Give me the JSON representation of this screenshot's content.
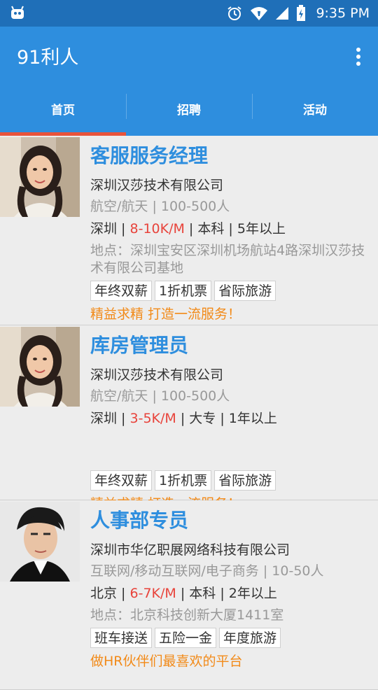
{
  "status_bar": {
    "time": "9:35 PM",
    "icons": [
      "android-debug-icon",
      "alarm-icon",
      "wifi-icon",
      "signal-icon",
      "battery-icon"
    ]
  },
  "app_bar": {
    "title": "91利人",
    "menu_icon": "more-vert-icon"
  },
  "tabs": [
    {
      "label": "首页",
      "selected": true
    },
    {
      "label": "招聘",
      "selected": false
    },
    {
      "label": "活动",
      "selected": false
    }
  ],
  "colors": {
    "status_bar": "#1f6fb8",
    "primary": "#2e8ede",
    "indicator": "#e8533b",
    "salary": "#e8433b",
    "slogan": "#f28a18"
  },
  "jobs": [
    {
      "title": "客服服务经理",
      "company": "深圳汉莎技术有限公司",
      "industry": "航空/航天 | 100-500人",
      "city": "深圳",
      "salary": "8-10K/M",
      "degree": "本科",
      "experience": "5年以上",
      "address": "地点：深圳宝安区深圳机场航站4路深圳汉莎技术有限公司基地",
      "tags": [
        "年终双薪",
        "1折机票",
        "省际旅游"
      ],
      "slogan": "精益求精 打造一流服务！"
    },
    {
      "title": "库房管理员",
      "company": "深圳汉莎技术有限公司",
      "industry": "航空/航天 | 100-500人",
      "city": "深圳",
      "salary": "3-5K/M",
      "degree": "大专",
      "experience": "1年以上",
      "address": "",
      "tags": [
        "年终双薪",
        "1折机票",
        "省际旅游"
      ],
      "slogan": "精益求精 打造一流服务！"
    },
    {
      "title": "人事部专员",
      "company": "深圳市华亿职展网络科技有限公司",
      "industry": "互联网/移动互联网/电子商务 | 10-50人",
      "city": "北京",
      "salary": "6-7K/M",
      "degree": "本科",
      "experience": "2年以上",
      "address": "地点：北京科技创新大厦1411室",
      "tags": [
        "班车接送",
        "五险一金",
        "年度旅游"
      ],
      "slogan": "做HR伙伴们最喜欢的平台"
    }
  ]
}
